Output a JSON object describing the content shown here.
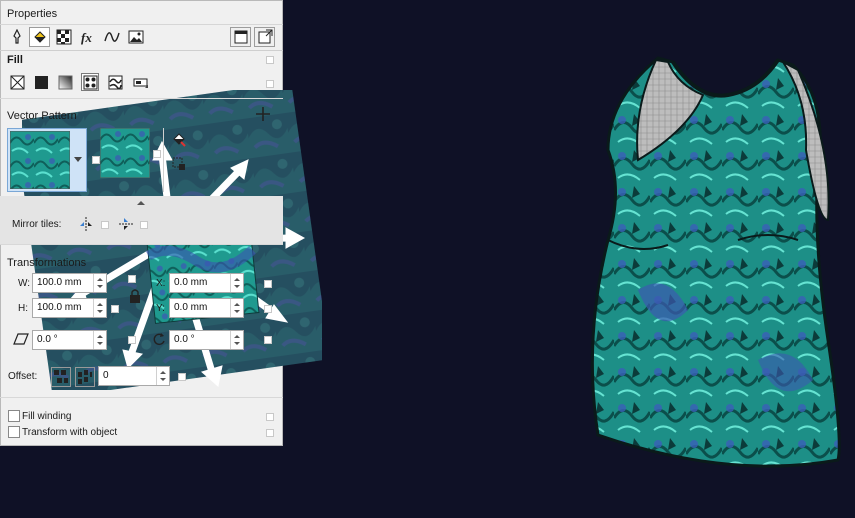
{
  "panel": {
    "title": "Properties",
    "tabs": [
      {
        "name": "outline-tab-icon"
      },
      {
        "name": "fill-tab-icon"
      },
      {
        "name": "transparency-tab-icon"
      },
      {
        "name": "effects-tab-icon"
      },
      {
        "name": "curve-tab-icon"
      },
      {
        "name": "bitmap-tab-icon"
      }
    ],
    "fill_section": "Fill",
    "fill_types": [
      "no-fill-icon",
      "uniform-fill-icon",
      "fountain-fill-icon",
      "vector-pattern-fill-icon",
      "texture-fill-icon",
      "postscript-fill-icon"
    ],
    "pattern_section": "Vector Pattern",
    "mirror_label": "Mirror tiles:",
    "transform_section": "Transformations",
    "w_label": "W:",
    "w_value": "100.0 mm",
    "h_label": "H:",
    "h_value": "100.0 mm",
    "x_label": "X:",
    "x_value": "0.0 mm",
    "y_label": "Y:",
    "y_value": "0.0 mm",
    "skew_value": "0.0 °",
    "rotate_value": "0.0 °",
    "offset_label": "Offset:",
    "offset_value": "0",
    "fill_winding_label": "Fill winding",
    "transform_with_object_label": "Transform with object"
  },
  "colors": {
    "background": "#0f1126",
    "pattern_teal": "#1f8f8a",
    "pattern_blue": "#3c5aa8",
    "panel_bg": "#f0f0f0"
  }
}
